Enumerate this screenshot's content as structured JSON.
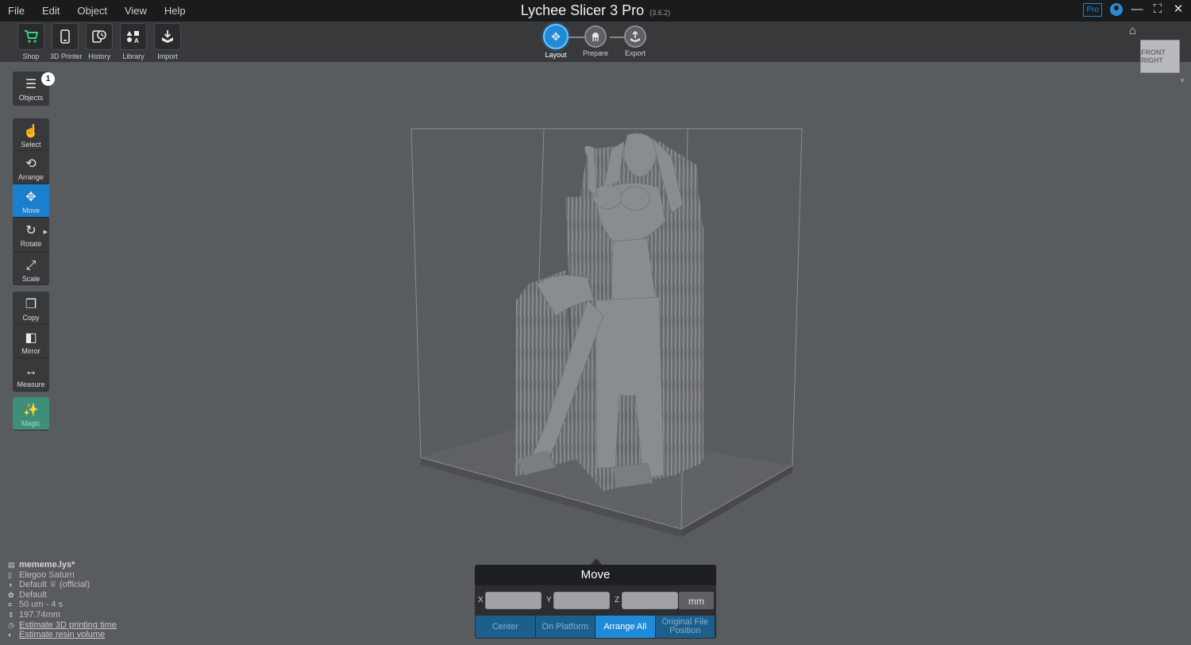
{
  "menu": [
    "File",
    "Edit",
    "Object",
    "View",
    "Help"
  ],
  "app": {
    "title": "Lychee Slicer 3 Pro",
    "version": "(3.6.2)",
    "pro_badge": "Pro"
  },
  "window_controls": {
    "minimize": "—",
    "maximize": "⛶",
    "close": "✕"
  },
  "toolbar": {
    "shop": "Shop",
    "printer": "3D Printer",
    "history": "History",
    "library": "Library",
    "import": "Import"
  },
  "workflow_steps": [
    {
      "label": "Layout",
      "active": true
    },
    {
      "label": "Prepare",
      "active": false
    },
    {
      "label": "Export",
      "active": false
    }
  ],
  "viewcube": {
    "face": "FRONT RIGHT"
  },
  "left_panel": {
    "objects": "Objects",
    "objects_count": "1",
    "select": "Select",
    "arrange": "Arrange",
    "move": "Move",
    "rotate": "Rotate",
    "scale": "Scale",
    "copy": "Copy",
    "mirror": "Mirror",
    "measure": "Measure",
    "magic": "Magic"
  },
  "move_panel": {
    "title": "Move",
    "x_label": "X",
    "y_label": "Y",
    "z_label": "Z",
    "x_value": "",
    "y_value": "",
    "z_value": "",
    "unit": "mm",
    "buttons": {
      "center": "Center",
      "on_platform": "On Platform",
      "arrange_all": "Arrange All",
      "original_line1": "Original File",
      "original_line2": "Position"
    }
  },
  "info": {
    "file": "mememe.lys*",
    "printer": "Elegoo Saturn",
    "resin": "Default ♕ (official)",
    "profile": "Default",
    "layers": "50 um - 4 s",
    "height": "197.74mm",
    "estimate_time": "Estimate 3D printing time",
    "estimate_resin": "Estimate resin volume"
  },
  "colors": {
    "accent": "#1f8ad8",
    "background": "#595c5f",
    "shop_green": "#2fd080",
    "magic": "#3d8f7a"
  }
}
